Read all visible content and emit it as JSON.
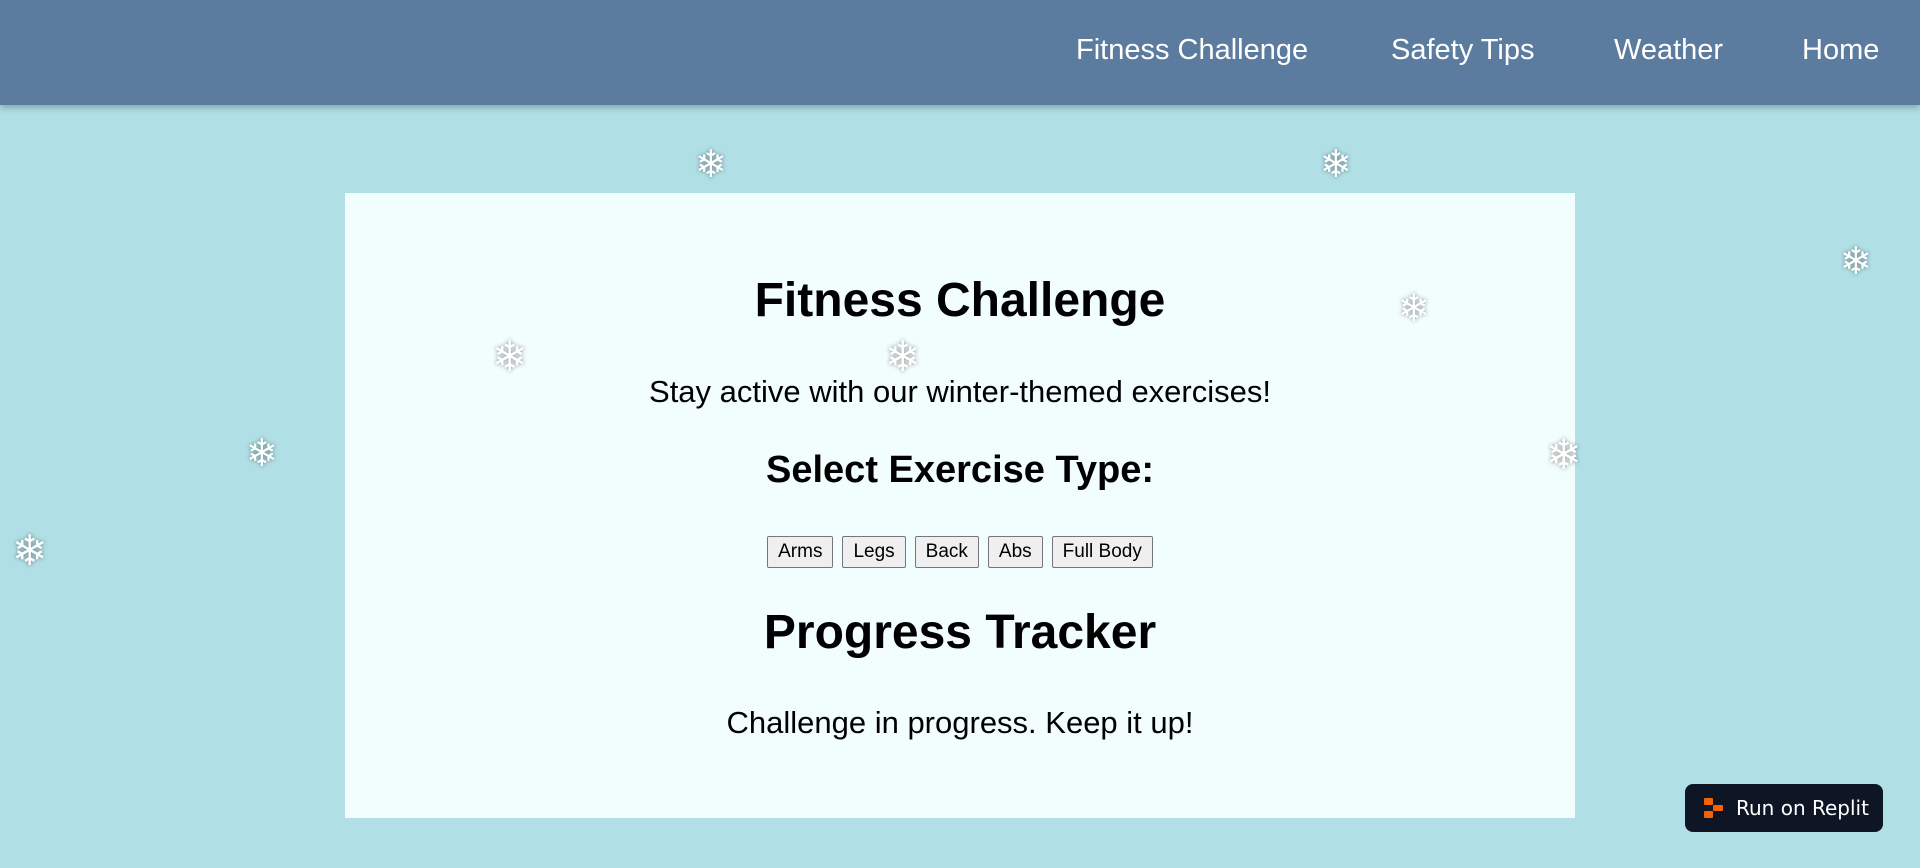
{
  "nav": {
    "items": [
      {
        "label": "Fitness Challenge"
      },
      {
        "label": "Safety Tips"
      },
      {
        "label": "Weather"
      },
      {
        "label": "Home"
      }
    ]
  },
  "card": {
    "title": "Fitness Challenge",
    "subtitle": "Stay active with our winter-themed exercises!",
    "select_heading": "Select Exercise Type:",
    "exercise_buttons": [
      {
        "label": "Arms"
      },
      {
        "label": "Legs"
      },
      {
        "label": "Back"
      },
      {
        "label": "Abs"
      },
      {
        "label": "Full Body"
      }
    ],
    "progress_heading": "Progress Tracker",
    "progress_text": "Challenge in progress. Keep it up!"
  },
  "decorations": {
    "snowflake_glyph": "❄",
    "snowflake_icon": "snowflake-icon"
  },
  "replit": {
    "label": "Run on Replit",
    "icon": "replit-logo-icon"
  },
  "colors": {
    "background": "#b0dfe5",
    "navbar": "#5b7c9f",
    "card": "#f2fdfd",
    "replit_button": "#0e1525",
    "replit_accent": "#f26207"
  }
}
